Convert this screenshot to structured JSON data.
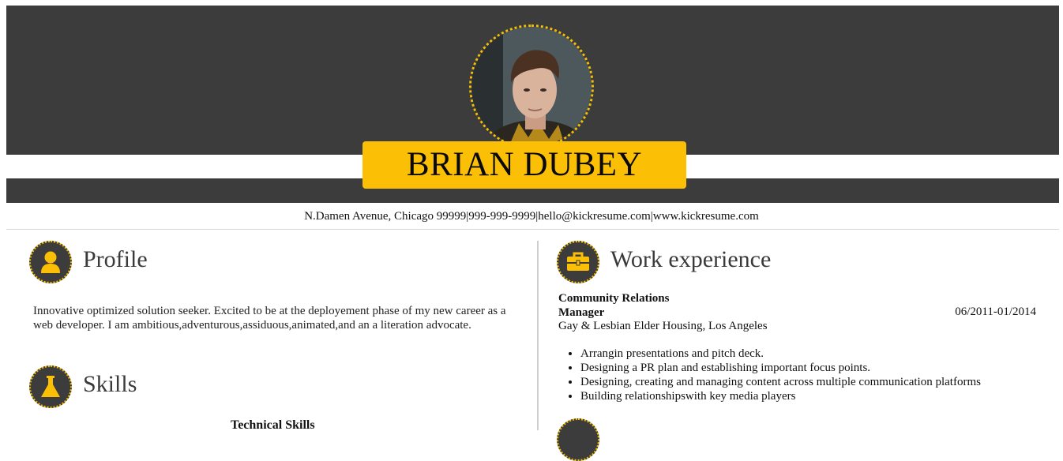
{
  "header": {
    "name": "BRIAN DUBEY",
    "contact": "N.Damen Avenue, Chicago 99999|999-999-9999|hello@kickresume.com|www.kickresume.com"
  },
  "colors": {
    "dark": "#3c3c3c",
    "accent": "#fbbf06"
  },
  "profile": {
    "icon": "user-icon",
    "title": "Profile",
    "text": "Innovative optimized solution seeker. Excited to be at the deployement phase of my new career as a web developer. I am ambitious,adventurous,assiduous,animated,and an a literation advocate."
  },
  "skills": {
    "icon": "flask-icon",
    "title": "Skills",
    "subheading": "Technical Skills"
  },
  "work": {
    "icon": "briefcase-icon",
    "title": "Work experience",
    "job": {
      "title_line1": "Community Relations",
      "title_line2": "Manager",
      "dates": "06/2011-01/2014",
      "company": "Gay & Lesbian Elder Housing, Los Angeles",
      "duties": [
        "Arrangin presentations and pitch deck.",
        "Designing a PR plan and establishing important focus points.",
        "Designing, creating and managing content across multiple communication platforms",
        "Building relationshipswith key media players"
      ]
    }
  }
}
